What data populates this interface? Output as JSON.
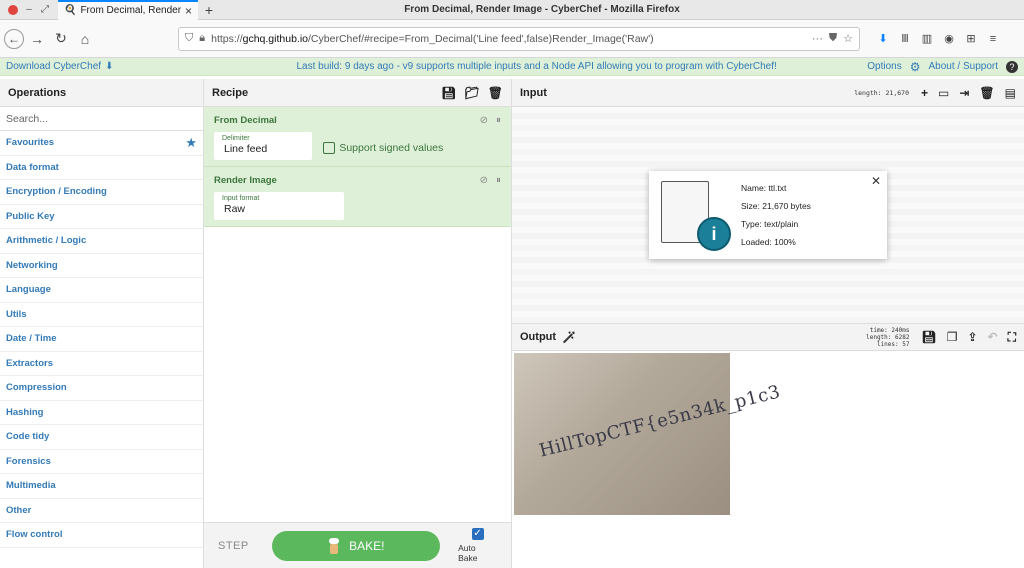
{
  "browser": {
    "tab_title": "From Decimal, Render Image",
    "window_title": "From Decimal, Render Image - CyberChef - Mozilla Firefox",
    "url_prefix": "https://",
    "url_host": "gchq.github.io",
    "url_path": "/CyberChef/#recipe=From_Decimal('Line feed',false)Render_Image('Raw')"
  },
  "banner": {
    "download": "Download CyberChef",
    "message": "Last build: 9 days ago - v9 supports multiple inputs and a Node API allowing you to program with CyberChef!",
    "options": "Options",
    "about": "About / Support"
  },
  "operations": {
    "title": "Operations",
    "search_placeholder": "Search...",
    "categories": [
      "Favourites",
      "Data format",
      "Encryption / Encoding",
      "Public Key",
      "Arithmetic / Logic",
      "Networking",
      "Language",
      "Utils",
      "Date / Time",
      "Extractors",
      "Compression",
      "Hashing",
      "Code tidy",
      "Forensics",
      "Multimedia",
      "Other",
      "Flow control"
    ]
  },
  "recipe": {
    "title": "Recipe",
    "ops": [
      {
        "name": "From Decimal",
        "field_label": "Delimiter",
        "field_value": "Line feed",
        "checkbox": "Support signed values"
      },
      {
        "name": "Render Image",
        "field_label": "Input format",
        "field_value": "Raw"
      }
    ],
    "step": "STEP",
    "bake": "BAKE!",
    "autobake": "Auto Bake"
  },
  "input": {
    "title": "Input",
    "length": "length: 21,670",
    "file": {
      "name": "Name: ttl.txt",
      "size": "Size: 21,670 bytes",
      "type": "Type: text/plain",
      "loaded": "Loaded: 100%"
    }
  },
  "output": {
    "title": "Output",
    "time": "time: 240ms",
    "length": "length: 6282",
    "lines": "lines:   57",
    "image_text": "HillTopCTF{e5n34k_p1c3"
  },
  "colors": {
    "accent": "#337ab7",
    "recipe_bg": "#dff0d8",
    "bake": "#5cb85c"
  }
}
